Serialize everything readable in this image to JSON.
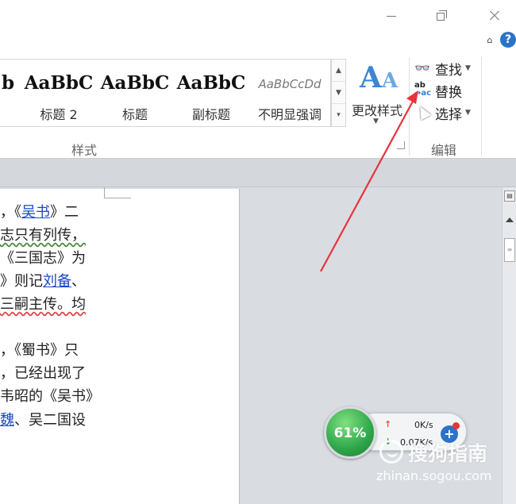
{
  "window": {
    "minimize_icon": "minimize-icon",
    "maximize_icon": "restore-icon",
    "close_icon": "close-icon",
    "collapse_ribbon": "⌂",
    "help": "?"
  },
  "ribbon": {
    "styles_group_label": "样式",
    "styles": [
      {
        "sample": "b",
        "label": ""
      },
      {
        "sample": "AaBbC",
        "label": "标题 2"
      },
      {
        "sample": "AaBbC",
        "label": "标题"
      },
      {
        "sample": "AaBbC",
        "label": "副标题"
      },
      {
        "sample": "AaBbCcDd",
        "label": "不明显强调"
      }
    ],
    "change_styles_label": "更改样式",
    "editing_group_label": "编辑",
    "find_label": "查找",
    "replace_label": "替换",
    "select_label": "选择"
  },
  "document": {
    "lines": [
      {
        "parts": [
          "，《",
          "吴书",
          "》二"
        ]
      },
      {
        "parts": [
          "志只有列传，"
        ]
      },
      {
        "parts": [
          "《三国志》为"
        ]
      },
      {
        "parts": [
          "》则记",
          "刘备",
          "、"
        ]
      },
      {
        "parts": [
          "三嗣主传。均"
        ]
      },
      {
        "parts": [
          "，《蜀书》只"
        ]
      },
      {
        "parts": [
          "，已经出现了"
        ]
      },
      {
        "parts": [
          "韦昭的《吴书》"
        ]
      },
      {
        "parts": [
          "魏",
          "、吴二国设"
        ]
      }
    ]
  },
  "net_widget": {
    "percent": "61%",
    "upload": "0K/s",
    "download": "0.07K/s",
    "up_arrow": "↑",
    "down_arrow": "↓",
    "plus": "+"
  },
  "watermark": {
    "brand": "搜狗指南",
    "url": "zhinan.sogou.com"
  },
  "colors": {
    "link": "#1a47c8",
    "annotation_arrow": "#e8333a",
    "help_blue": "#2b73c9"
  }
}
